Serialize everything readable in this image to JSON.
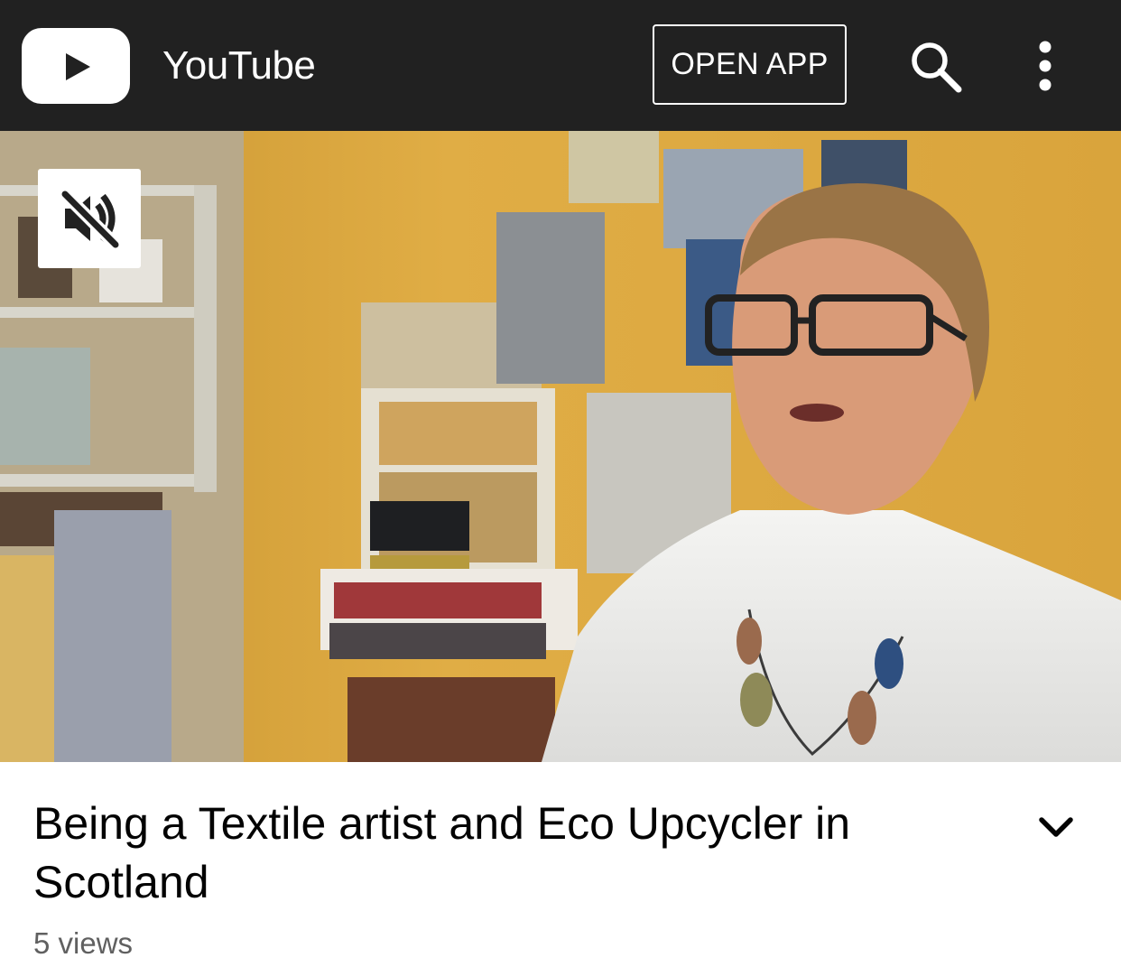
{
  "app_bar": {
    "logo_icon": "youtube-play-icon",
    "brand_name": "YouTube",
    "open_app_label": "OPEN APP",
    "search_icon": "search-icon",
    "more_icon": "more-vertical-icon",
    "background_color": "#212121"
  },
  "player": {
    "mute_icon": "volume-off-icon"
  },
  "video": {
    "title": "Being a Textile artist and Eco Upcycler in Scotland",
    "views": "5 views",
    "expand_icon": "chevron-down-icon"
  }
}
